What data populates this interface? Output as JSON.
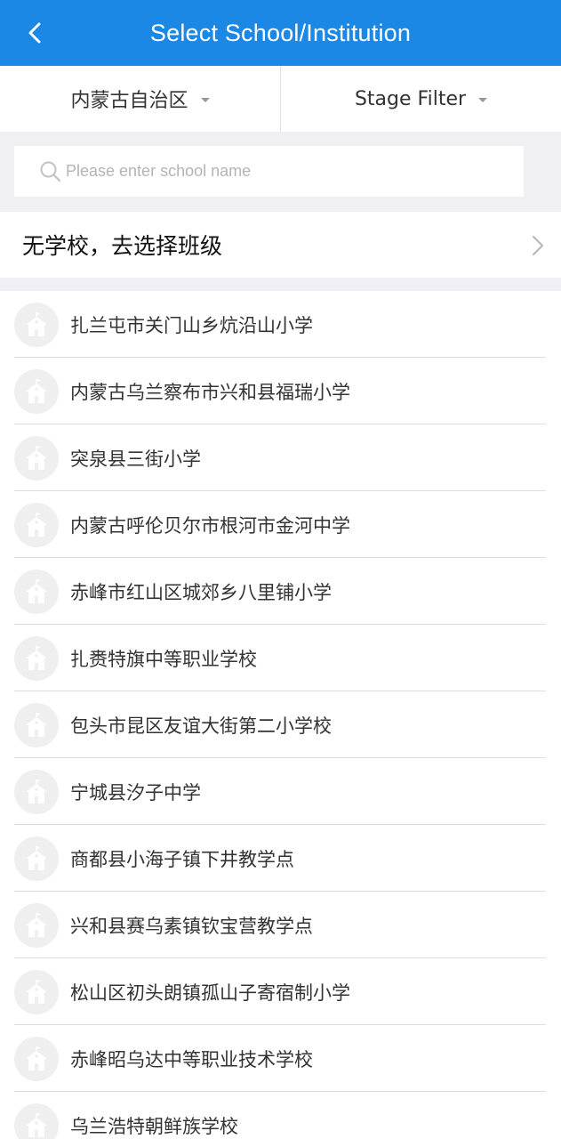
{
  "header": {
    "title": "Select School/Institution"
  },
  "filters": {
    "region": "内蒙古自治区",
    "stage": "Stage Filter"
  },
  "search": {
    "placeholder": "Please enter school name"
  },
  "no_school": {
    "label": "无学校，去选择班级"
  },
  "schools": [
    "扎兰屯市关门山乡炕沿山小学",
    "内蒙古乌兰察布市兴和县福瑞小学",
    "突泉县三街小学",
    "内蒙古呼伦贝尔市根河市金河中学",
    "赤峰市红山区城郊乡八里铺小学",
    "扎赉特旗中等职业学校",
    "包头市昆区友谊大街第二小学校",
    "宁城县汐子中学",
    "商都县小海子镇下井教学点",
    "兴和县赛乌素镇钦宝营教学点",
    "松山区初头朗镇孤山子寄宿制小学",
    "赤峰昭乌达中等职业技术学校",
    "乌兰浩特朝鲜族学校"
  ],
  "colors": {
    "header_bg": "#1c88e6",
    "page_bg": "#efeff4",
    "icon_bg": "#efefef",
    "icon_fg": "#ffffff"
  },
  "icons": {
    "back": "chevron-left-icon",
    "search": "search-icon",
    "forward": "chevron-right-icon",
    "school": "school-building-icon"
  }
}
